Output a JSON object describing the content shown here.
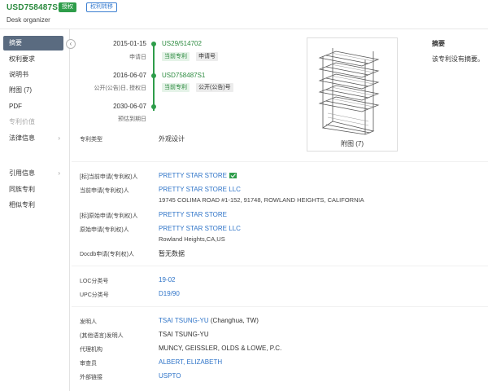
{
  "header": {
    "patent_number": "USD758487S1",
    "status_badge": "授权",
    "transfer_badge": "权利转移",
    "title": "Desk organizer"
  },
  "sidebar": {
    "collapse_icon": "chevron-left-icon",
    "items": [
      {
        "label": "摘要",
        "active": true
      },
      {
        "label": "权利要求"
      },
      {
        "label": "说明书"
      },
      {
        "label": "附图 (7)"
      },
      {
        "label": "PDF"
      },
      {
        "label": "专利价值",
        "disabled": true
      },
      {
        "label": "法律信息",
        "expandable": true
      },
      {
        "label": "引用信息",
        "expandable": true
      },
      {
        "label": "同族专利"
      },
      {
        "label": "相似专利"
      }
    ]
  },
  "timeline": {
    "events": [
      {
        "date": "2015-01-15",
        "sub": "申请日",
        "number": "US29/514702",
        "tags": [
          "当前专利",
          "申请号"
        ]
      },
      {
        "date": "2016-06-07",
        "sub": "公开(公告)日, 授权日",
        "number": "USD758487S1",
        "tags": [
          "当前专利",
          "公开(公告)号"
        ]
      },
      {
        "date": "2030-06-07",
        "sub": "预估到期日"
      }
    ]
  },
  "figure": {
    "caption": "附图 (7)"
  },
  "abstract": {
    "title": "摘要",
    "text": "该专利没有摘要。"
  },
  "details": {
    "patent_type": {
      "label": "专利类型",
      "value": "外观设计"
    },
    "std_current_assignee": {
      "label": "[标]当前申请(专利权)人",
      "value": "PRETTY STAR STORE"
    },
    "current_assignee": {
      "label": "当前申请(专利权)人",
      "value": "PRETTY STAR STORE LLC",
      "address": "19745 COLIMA ROAD #1-152, 91748, ROWLAND HEIGHTS, CALIFORNIA"
    },
    "std_original_assignee": {
      "label": "[标]原始申请(专利权)人",
      "value": "PRETTY STAR STORE"
    },
    "original_assignee": {
      "label": "原始申请(专利权)人",
      "value": "PRETTY STAR STORE LLC",
      "address": "Rowland Heights,CA,US"
    },
    "docdb_assignee": {
      "label": "Docdb申请(专利权)人",
      "value": "暂无数据"
    },
    "loc": {
      "label": "LOC分类号",
      "value": "19-02"
    },
    "upc": {
      "label": "UPC分类号",
      "value": "D19/90"
    },
    "inventor": {
      "label": "发明人",
      "value": "TSAI TSUNG-YU",
      "extra": "(Changhua, TW)"
    },
    "inventor_other": {
      "label": "(其他语言)发明人",
      "value": "TSAI TSUNG-YU"
    },
    "agency": {
      "label": "代理机构",
      "value": "MUNCY, GEISSLER, OLDS & LOWE, P.C."
    },
    "examiner": {
      "label": "审查员",
      "value": "ALBERT, ELIZABETH"
    },
    "external_link": {
      "label": "外部链接",
      "value": "USPTO"
    }
  },
  "colors": {
    "green": "#2e9d4a",
    "link": "#2f74c8",
    "sidebar_active": "#5a6b80"
  }
}
